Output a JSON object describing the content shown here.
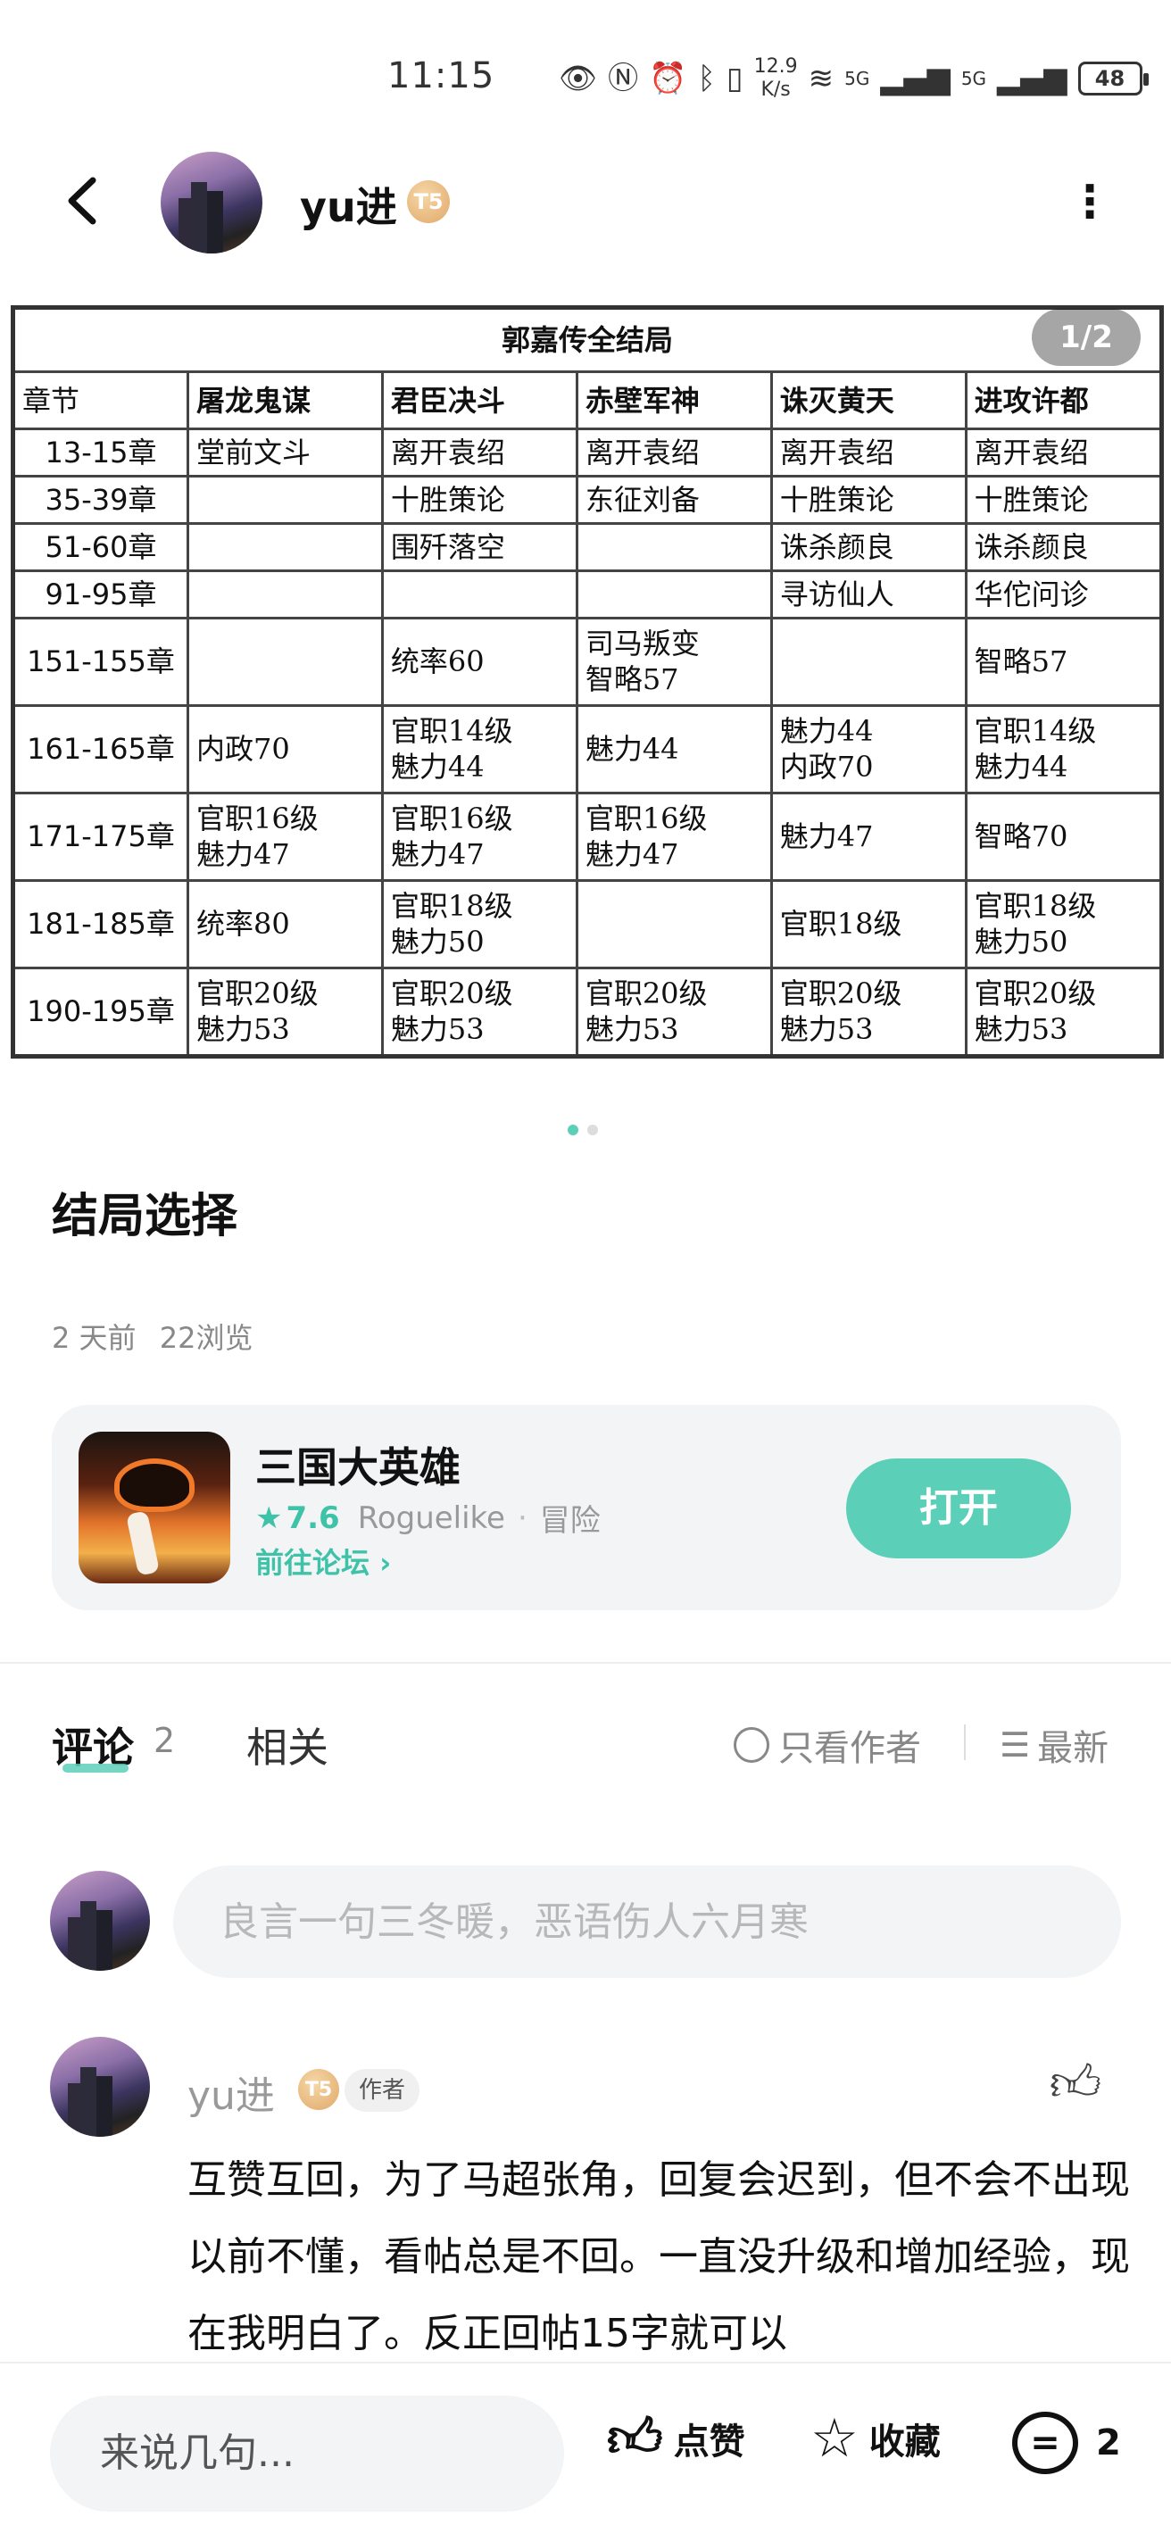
{
  "status_bar": {
    "time": "11:15",
    "net_speed_value": "12.9",
    "net_speed_unit": "K/s",
    "signal_1": "5G",
    "signal_2": "5G",
    "battery": "48",
    "icons": [
      "eye-icon",
      "nfc-icon",
      "alarm-icon",
      "bluetooth-icon",
      "vibrate-icon",
      "wifi-icon",
      "signal-icon",
      "signal-icon",
      "battery-icon"
    ]
  },
  "header": {
    "username": "yu进",
    "level_badge": "T5"
  },
  "image": {
    "page_indicator": "1/2",
    "table": {
      "title": "郭嘉传全结局",
      "columns": [
        "章节",
        "屠龙鬼谋",
        "君臣决斗",
        "赤壁军神",
        "诛灭黄天",
        "进攻许都"
      ],
      "rows": [
        [
          "13-15章",
          "堂前文斗",
          "离开袁绍",
          "离开袁绍",
          "离开袁绍",
          "离开袁绍"
        ],
        [
          "35-39章",
          "",
          "十胜策论",
          "东征刘备",
          "十胜策论",
          "十胜策论"
        ],
        [
          "51-60章",
          "",
          "围歼落空",
          "",
          "诛杀颜良",
          "诛杀颜良"
        ],
        [
          "91-95章",
          "",
          "",
          "",
          "寻访仙人",
          "华佗问诊"
        ],
        [
          "151-155章",
          "",
          "统率60",
          "司马叛变\n智略57",
          "",
          "智略57"
        ],
        [
          "161-165章",
          "内政70",
          "官职14级\n魅力44",
          "魅力44",
          "魅力44\n内政70",
          "官职14级\n魅力44"
        ],
        [
          "171-175章",
          "官职16级\n魅力47",
          "官职16级\n魅力47",
          "官职16级\n魅力47",
          "魅力47",
          "智略70"
        ],
        [
          "181-185章",
          "统率80",
          "官职18级\n魅力50",
          "",
          "官职18级",
          "官职18级\n魅力50"
        ],
        [
          "190-195章",
          "官职20级\n魅力53",
          "官职20级\n魅力53",
          "官职20级\n魅力53",
          "官职20级\n魅力53",
          "官职20级\n魅力53"
        ]
      ]
    }
  },
  "post": {
    "title": "结局选择",
    "time_ago": "2 天前",
    "views": "22浏览"
  },
  "game_card": {
    "name": "三国大英雄",
    "rating": "7.6",
    "tag1": "Roguelike",
    "separator": "·",
    "tag2": "冒险",
    "forum_link": "前往论坛",
    "open_button": "打开",
    "accent_color": "#5ccfb9"
  },
  "comments_section": {
    "tab_comment": "评论",
    "comment_count": "2",
    "tab_related": "相关",
    "author_only": "只看作者",
    "sort": "最新",
    "input_placeholder": "良言一句三冬暖，恶语伤人六月寒"
  },
  "comment": {
    "username": "yu进",
    "level_badge": "T5",
    "author_tag": "作者",
    "text": "互赞互回，为了马超张角，回复会迟到，但不会不出现 以前不懂，看帖总是不回。一直没升级和增加经验，现在我明白了。反正回帖15字就可以"
  },
  "bottom_bar": {
    "input_placeholder": "来说几句...",
    "like_label": "点赞",
    "favorite_label": "收藏",
    "comment_count": "2"
  }
}
